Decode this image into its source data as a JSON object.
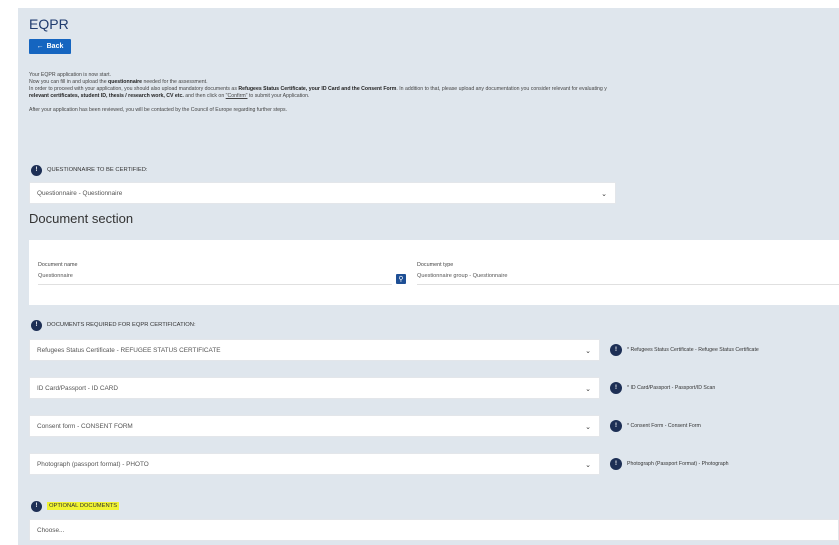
{
  "header": {
    "title": "EQPR",
    "back_label": "Back"
  },
  "intro": {
    "line1": "Your EQPR application is now start.",
    "line2a": "Now you can fill in and upload the ",
    "line2b": "questionnaire",
    "line2c": " needed for the assessment.",
    "line3a": "In order to proceed with your application, you should also upload mandatory documents as ",
    "line3b": "Refugees Status Certificate, your ID Card and the Consent Form",
    "line3c": ". In addition to that, please upload any documentation you consider relevant for evaluating y",
    "line4a": "relevant certificates, student ID, thesis / research work, CV etc.",
    "line4b": " and then click on ",
    "line4c": "\"Confirm\"",
    "line4d": " to submit your Application.",
    "line5": "After your application has been reviewed, you will be contacted by the Council of Europe regarding further steps."
  },
  "questionnaire": {
    "heading": "QUESTIONNAIRE TO BE CERTIFIED:",
    "selected": "Questionnaire - Questionnaire"
  },
  "document_section": {
    "title": "Document section",
    "name_label": "Document name",
    "name_value": "Questionnaire",
    "type_label": "Document type",
    "type_value": "Questionnaire group - Questionnaire"
  },
  "required": {
    "heading": "DOCUMENTS REQUIRED FOR EQPR CERTIFICATION:",
    "items": [
      {
        "select": "Refugees Status Certificate - REFUGEE STATUS CERTIFICATE",
        "label": "* Refugees Status Certificate - Refugee Status Certificate"
      },
      {
        "select": "ID Card/Passport - ID CARD",
        "label": "* ID Card/Passport - Passport/ID Scan"
      },
      {
        "select": "Consent form - CONSENT FORM",
        "label": "* Consent Form - Consent Form"
      },
      {
        "select": "Photograph (passport format) - PHOTO",
        "label": "Photograph (Passport Format) - Photograph"
      }
    ]
  },
  "optional": {
    "heading": "OPTIONAL DOCUMENTS",
    "placeholder": "Choose..."
  },
  "icons": {
    "back": "arrow-left-icon",
    "chevron": "chevron-down-icon",
    "search": "search-icon",
    "section": "info-circle-icon"
  },
  "colors": {
    "accent": "#1565c0",
    "icon_dark": "#1d2f55",
    "highlight": "#f1f433",
    "background": "#dfe6ed"
  }
}
